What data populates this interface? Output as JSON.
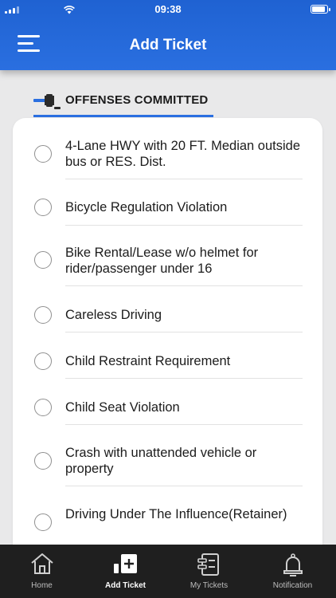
{
  "status_bar": {
    "time": "09:38"
  },
  "header": {
    "title": "Add Ticket"
  },
  "section": {
    "title": "OFFENSES COMMITTED"
  },
  "offenses": [
    {
      "label": "4-Lane HWY with 20 FT. Median outside bus or RES. Dist."
    },
    {
      "label": "Bicycle Regulation Violation"
    },
    {
      "label": "Bike Rental/Lease w/o helmet for rider/passenger under 16"
    },
    {
      "label": "Careless Driving"
    },
    {
      "label": "Child Restraint Requirement"
    },
    {
      "label": "Child Seat Violation"
    },
    {
      "label": "Crash with unattended vehicle or property"
    },
    {
      "label": "Driving Under The Influence(Retainer)"
    }
  ],
  "tabs": [
    {
      "label": "Home",
      "icon": "home-icon"
    },
    {
      "label": "Add Ticket",
      "icon": "add-ticket-icon",
      "active": true
    },
    {
      "label": "My Tickets",
      "icon": "tickets-icon"
    },
    {
      "label": "Notification",
      "icon": "bell-icon"
    }
  ],
  "colors": {
    "primary": "#2a6fe0",
    "tabbar": "#1f1f1f"
  }
}
